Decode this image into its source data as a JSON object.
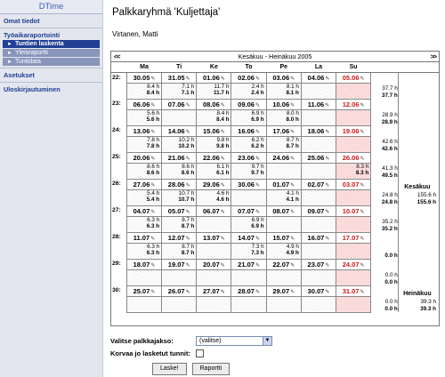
{
  "sidebar": {
    "brand": "DTime",
    "items": [
      {
        "label": "Omat tiedot"
      },
      {
        "label": "Työaikaraportointi"
      },
      {
        "label": "Tuntien laskenta"
      },
      {
        "label": "Yleisraportti"
      },
      {
        "label": "Tuntidata"
      },
      {
        "label": "Asetukset"
      },
      {
        "label": "Uloskirjautuminen"
      }
    ]
  },
  "page": {
    "title": "Palkkaryhmä 'Kuljettaja'",
    "user": "Virtanen, Matti"
  },
  "calendar": {
    "prev": "<<",
    "next": ">>",
    "period": "Kesäkuu - Heinäkuu 2005",
    "days": [
      "Ma",
      "Ti",
      "Ke",
      "To",
      "Pe",
      "La",
      "Su"
    ],
    "edit_icon": "edit-icon",
    "weeks": [
      {
        "wk": "22:",
        "dates": [
          "30.05",
          "31.05",
          "01.06",
          "02.06",
          "03.06",
          "04.06",
          "05.06"
        ],
        "a": [
          "8.4 h",
          "7.1 h",
          "11.7 h",
          "2.4 h",
          "8.1 h",
          "",
          ""
        ],
        "b": [
          "8.4 h",
          "7.1 h",
          "11.7 h",
          "2.4 h",
          "8.1 h",
          "",
          ""
        ],
        "sa": "37.7 h",
        "sb": "37.7 h"
      },
      {
        "wk": "23:",
        "dates": [
          "06.06",
          "07.06",
          "08.06",
          "09.06",
          "10.06",
          "11.06",
          "12.06"
        ],
        "a": [
          "5.6 h",
          "",
          "8.4 h",
          "6.9 h",
          "8.0 h",
          "",
          ""
        ],
        "b": [
          "5.6 h",
          "",
          "8.4 h",
          "6.9 h",
          "8.0 h",
          "",
          ""
        ],
        "sa": "28.9 h",
        "sb": "28.9 h"
      },
      {
        "wk": "24:",
        "dates": [
          "13.06",
          "14.06",
          "15.06",
          "16.06",
          "17.06",
          "18.06",
          "19.06"
        ],
        "a": [
          "7.8 h",
          "10.2 h",
          "9.8 h",
          "6.2 h",
          "8.7 h",
          "",
          ""
        ],
        "b": [
          "7.8 h",
          "10.2 h",
          "9.8 h",
          "6.2 h",
          "8.7 h",
          "",
          ""
        ],
        "sa": "42.6 h",
        "sb": "42.6 h"
      },
      {
        "wk": "25:",
        "dates": [
          "20.06",
          "21.06",
          "22.06",
          "23.06",
          "24.06",
          "25.06",
          "26.06"
        ],
        "a": [
          "8.6 h",
          "8.6 h",
          "6.1 h",
          "9.7 h",
          "",
          "",
          "8.3 h"
        ],
        "b": [
          "8.6 h",
          "8.6 h",
          "6.1 h",
          "9.7 h",
          "",
          "",
          "8.3 h"
        ],
        "sa": "41.3 h",
        "sb": "49.5 h"
      },
      {
        "wk": "26:",
        "dates": [
          "27.06",
          "28.06",
          "29.06",
          "30.06",
          "01.07",
          "02.07",
          "03.07"
        ],
        "a": [
          "5.4 h",
          "10.7 h",
          "4.6 h",
          "",
          "4.1 h",
          "",
          ""
        ],
        "b": [
          "5.4 h",
          "10.7 h",
          "4.6 h",
          "",
          "4.1 h",
          "",
          ""
        ],
        "sa": "24.8 h",
        "sb": "24.8 h"
      },
      {
        "wk": "27:",
        "dates": [
          "04.07",
          "05.07",
          "06.07",
          "07.07",
          "08.07",
          "09.07",
          "10.07"
        ],
        "a": [
          "6.3 h",
          "8.7 h",
          "",
          "6.9 h",
          "",
          "",
          ""
        ],
        "b": [
          "6.3 h",
          "8.7 h",
          "",
          "6.9 h",
          "",
          "",
          ""
        ],
        "sa": "35.2 h",
        "sb": "35.2 h"
      },
      {
        "wk": "28:",
        "dates": [
          "11.07",
          "12.07",
          "13.07",
          "14.07",
          "15.07",
          "16.07",
          "17.07"
        ],
        "a": [
          "6.3 h",
          "8.7 h",
          "",
          "7.3 h",
          "4.9 h",
          "",
          ""
        ],
        "b": [
          "6.3 h",
          "8.7 h",
          "",
          "7.3 h",
          "4.9 h",
          "",
          ""
        ],
        "sa": "",
        "sb": "0.0 h"
      },
      {
        "wk": "29:",
        "dates": [
          "18.07",
          "19.07",
          "20.07",
          "21.07",
          "22.07",
          "23.07",
          "24.07"
        ],
        "a": [
          "",
          "",
          "",
          "",
          "",
          "",
          ""
        ],
        "b": [
          "",
          "",
          "",
          "",
          "",
          "",
          ""
        ],
        "sa": "0.0 h",
        "sb": "0.0 h"
      },
      {
        "wk": "30:",
        "dates": [
          "25.07",
          "26.07",
          "27.07",
          "28.07",
          "29.07",
          "30.07",
          "31.07"
        ],
        "a": [
          "",
          "",
          "",
          "",
          "",
          "",
          ""
        ],
        "b": [
          "",
          "",
          "",
          "",
          "",
          "",
          ""
        ],
        "sa": "0.0 h",
        "sb": "0.0 h"
      }
    ],
    "months": [
      {
        "name": "Kesäkuu",
        "a": "155.6 h",
        "b": "155.6 h"
      },
      {
        "name": "Heinäkuu",
        "a": "39.3 h",
        "b": "39.3 h"
      }
    ]
  },
  "form": {
    "period_label": "Valitse palkkajakso:",
    "period_value": "(valitse)",
    "override_label": "Korvaa jo lasketut tunnit:",
    "calc_button": "Laske!",
    "report_button": "Raportti"
  }
}
